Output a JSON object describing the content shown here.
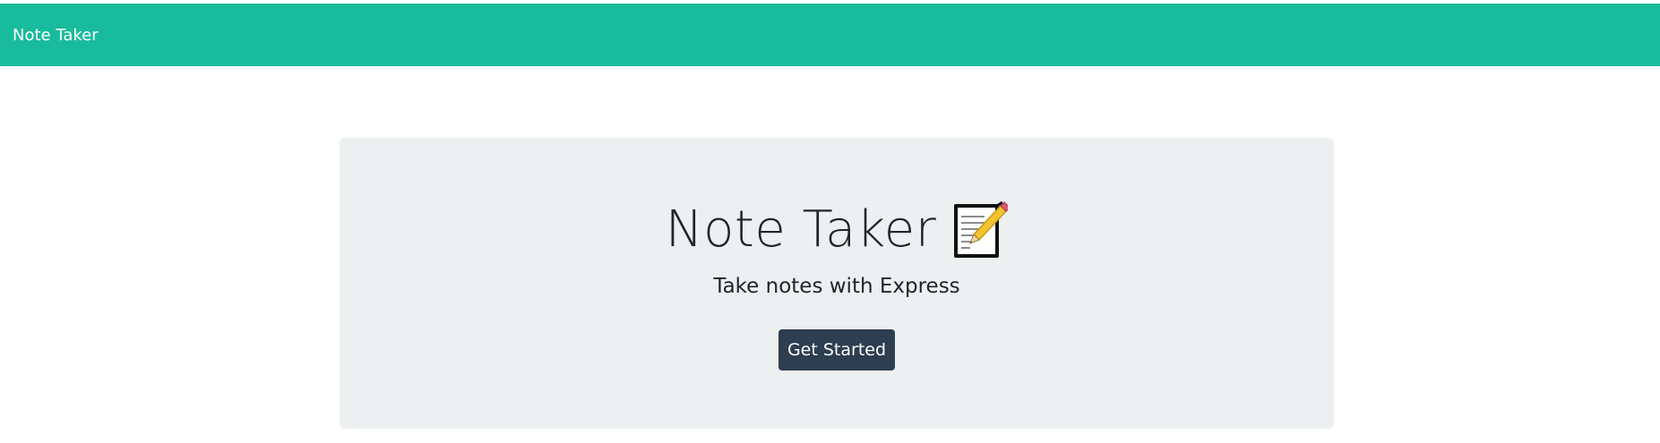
{
  "navbar": {
    "brand": "Note Taker",
    "background_color": "#18bc9c"
  },
  "hero": {
    "title": "Note Taker",
    "title_icon": "memo-icon",
    "subtitle": "Take notes with Express",
    "cta_label": "Get Started",
    "cta_color": "#2c3e50",
    "panel_color": "#ecf0f1"
  }
}
